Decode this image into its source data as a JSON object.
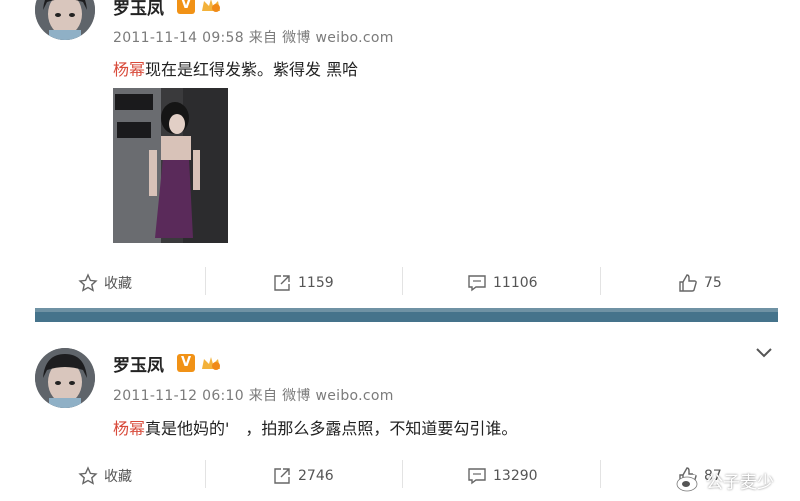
{
  "posts": [
    {
      "username": "罗玉凤",
      "badge": "V",
      "timestamp": "2011-11-14 09:58",
      "source_prefix": "来自",
      "source": "微博 weibo.com",
      "mention": "杨幂",
      "body": "现在是红得发紫。紫得发 黑哈",
      "actions": {
        "favorite": "收藏",
        "repost": "1159",
        "comment": "11106",
        "like": "75"
      }
    },
    {
      "username": "罗玉凤",
      "badge": "V",
      "timestamp": "2011-11-12 06:10",
      "source_prefix": "来自",
      "source": "微博 weibo.com",
      "mention": "杨幂",
      "body": "真是他妈的'　，拍那么多露点照，不知道要勾引谁。",
      "actions": {
        "favorite": "收藏",
        "repost": "2746",
        "comment": "13290",
        "like": "87"
      }
    }
  ],
  "watermark": "公子麦少",
  "colors": {
    "mention": "#d84a3a",
    "divider": "#45738b",
    "vip_badge": "#f19216"
  },
  "icons": [
    "star-icon",
    "repost-icon",
    "comment-icon",
    "thumbs-up-icon",
    "chevron-down-icon",
    "weibo-logo-icon"
  ]
}
